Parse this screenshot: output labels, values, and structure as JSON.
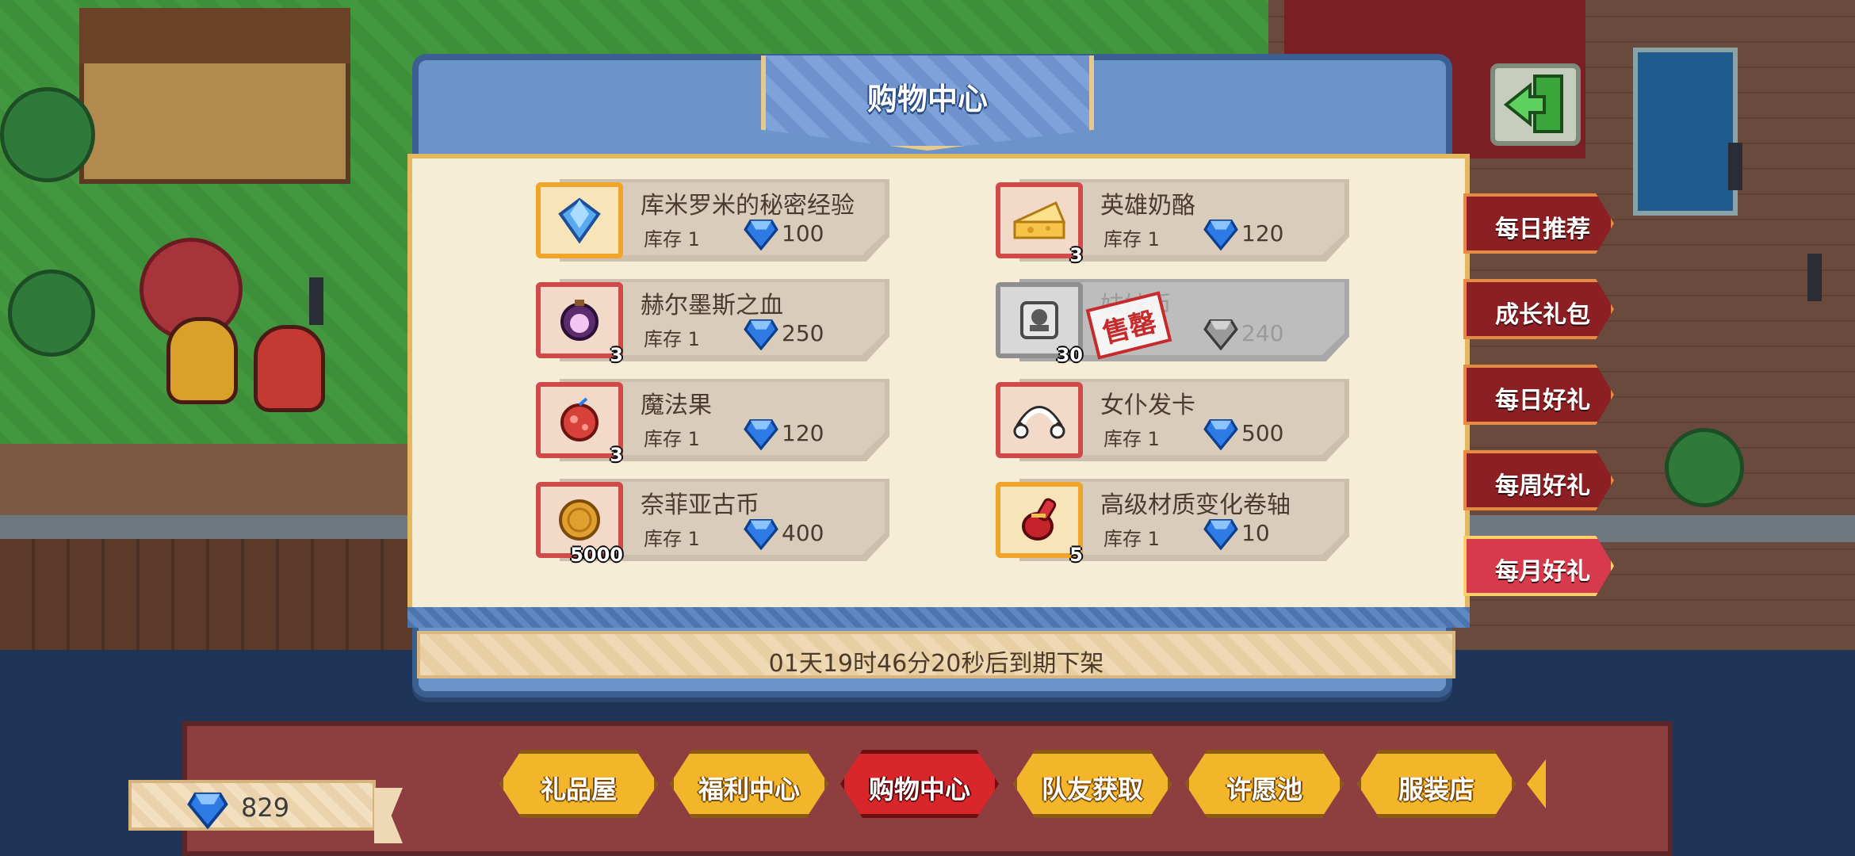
{
  "shop": {
    "title": "购物中心",
    "countdown": "01天19时46分20秒后到期下架",
    "items": [
      {
        "name": "库米罗米的秘密经验",
        "stock": "库存 1",
        "price": "100",
        "qty": "",
        "icon": "blue-gem-crystal-icon",
        "frame": "gold"
      },
      {
        "name": "英雄奶酪",
        "stock": "库存 1",
        "price": "120",
        "qty": "3",
        "icon": "cheese-icon",
        "frame": "red"
      },
      {
        "name": "赫尔墨斯之血",
        "stock": "库存 1",
        "price": "250",
        "qty": "3",
        "icon": "potion-orb-icon",
        "frame": "red"
      },
      {
        "name": "妹妹币",
        "stock": "",
        "price": "240",
        "qty": "30",
        "icon": "token-icon",
        "frame": "grey",
        "sold_out_label": "售罄"
      },
      {
        "name": "魔法果",
        "stock": "库存 1",
        "price": "120",
        "qty": "3",
        "icon": "magic-fruit-icon",
        "frame": "red"
      },
      {
        "name": "女仆发卡",
        "stock": "库存 1",
        "price": "500",
        "qty": "",
        "icon": "maid-headband-icon",
        "frame": "red"
      },
      {
        "name": "奈菲亚古币",
        "stock": "库存 1",
        "price": "400",
        "qty": "5000",
        "icon": "gold-coin-icon",
        "frame": "red"
      },
      {
        "name": "高级材质变化卷轴",
        "stock": "库存 1",
        "price": "10",
        "qty": "5",
        "icon": "scroll-bag-icon",
        "frame": "gold"
      }
    ]
  },
  "side_tabs": [
    {
      "label": "每日推荐",
      "active": false
    },
    {
      "label": "成长礼包",
      "active": false
    },
    {
      "label": "每日好礼",
      "active": false
    },
    {
      "label": "每周好礼",
      "active": false
    },
    {
      "label": "每月好礼",
      "active": true
    }
  ],
  "currency": {
    "gems": "829"
  },
  "bottom_nav": [
    {
      "label": "礼品屋",
      "active": false
    },
    {
      "label": "福利中心",
      "active": false
    },
    {
      "label": "购物中心",
      "active": true
    },
    {
      "label": "队友获取",
      "active": false
    },
    {
      "label": "许愿池",
      "active": false
    },
    {
      "label": "服装店",
      "active": false
    }
  ],
  "colors": {
    "accent_red": "#d9262a",
    "gold": "#f3b62a",
    "panel_blue": "#6b94c9",
    "gem_blue": "#2f7be6"
  }
}
